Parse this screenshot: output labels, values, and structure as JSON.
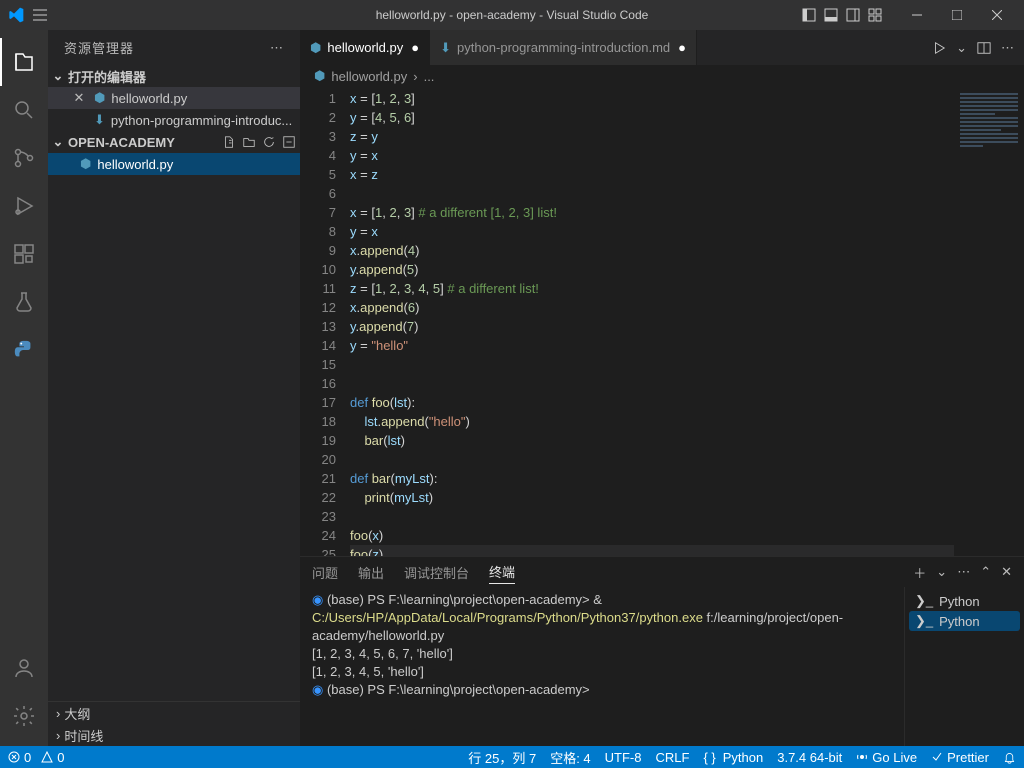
{
  "titlebar": {
    "title": "helloworld.py - open-academy - Visual Studio Code"
  },
  "sidebar": {
    "title": "资源管理器",
    "open_editors_label": "打开的编辑器",
    "open_editors": [
      {
        "name": "helloworld.py",
        "icon": "python"
      },
      {
        "name": "python-programming-introduc...",
        "icon": "markdown"
      }
    ],
    "folder": "OPEN-ACADEMY",
    "files": [
      {
        "name": "helloworld.py",
        "icon": "python"
      }
    ],
    "outline_label": "大纲",
    "timeline_label": "时间线"
  },
  "tabs": [
    {
      "name": "helloworld.py",
      "icon": "python",
      "active": true,
      "modified": true
    },
    {
      "name": "python-programming-introduction.md",
      "icon": "markdown",
      "active": false,
      "modified": true
    }
  ],
  "breadcrumb": {
    "file": "helloworld.py",
    "more": "..."
  },
  "code": {
    "lines": [
      {
        "n": 1,
        "html": "<span class='v'>x</span> <span class='p'>=</span> <span class='p'>[</span><span class='n'>1</span><span class='p'>,</span> <span class='n'>2</span><span class='p'>,</span> <span class='n'>3</span><span class='p'>]</span>"
      },
      {
        "n": 2,
        "html": "<span class='v'>y</span> <span class='p'>=</span> <span class='p'>[</span><span class='n'>4</span><span class='p'>,</span> <span class='n'>5</span><span class='p'>,</span> <span class='n'>6</span><span class='p'>]</span>"
      },
      {
        "n": 3,
        "html": "<span class='v'>z</span> <span class='p'>=</span> <span class='v'>y</span>"
      },
      {
        "n": 4,
        "html": "<span class='v'>y</span> <span class='p'>=</span> <span class='v'>x</span>"
      },
      {
        "n": 5,
        "html": "<span class='v'>x</span> <span class='p'>=</span> <span class='v'>z</span>"
      },
      {
        "n": 6,
        "html": ""
      },
      {
        "n": 7,
        "html": "<span class='v'>x</span> <span class='p'>=</span> <span class='p'>[</span><span class='n'>1</span><span class='p'>,</span> <span class='n'>2</span><span class='p'>,</span> <span class='n'>3</span><span class='p'>]</span> <span class='c'># a different [1, 2, 3] list!</span>"
      },
      {
        "n": 8,
        "html": "<span class='v'>y</span> <span class='p'>=</span> <span class='v'>x</span>"
      },
      {
        "n": 9,
        "html": "<span class='v'>x</span><span class='p'>.</span><span class='f'>append</span><span class='p'>(</span><span class='n'>4</span><span class='p'>)</span>"
      },
      {
        "n": 10,
        "html": "<span class='v'>y</span><span class='p'>.</span><span class='f'>append</span><span class='p'>(</span><span class='n'>5</span><span class='p'>)</span>"
      },
      {
        "n": 11,
        "html": "<span class='v'>z</span> <span class='p'>=</span> <span class='p'>[</span><span class='n'>1</span><span class='p'>,</span> <span class='n'>2</span><span class='p'>,</span> <span class='n'>3</span><span class='p'>,</span> <span class='n'>4</span><span class='p'>,</span> <span class='n'>5</span><span class='p'>]</span> <span class='c'># a different list!</span>"
      },
      {
        "n": 12,
        "html": "<span class='v'>x</span><span class='p'>.</span><span class='f'>append</span><span class='p'>(</span><span class='n'>6</span><span class='p'>)</span>"
      },
      {
        "n": 13,
        "html": "<span class='v'>y</span><span class='p'>.</span><span class='f'>append</span><span class='p'>(</span><span class='n'>7</span><span class='p'>)</span>"
      },
      {
        "n": 14,
        "html": "<span class='v'>y</span> <span class='p'>=</span> <span class='s'>\"hello\"</span>"
      },
      {
        "n": 15,
        "html": ""
      },
      {
        "n": 16,
        "html": ""
      },
      {
        "n": 17,
        "html": "<span class='k'>def</span> <span class='f'>foo</span><span class='p'>(</span><span class='v'>lst</span><span class='p'>):</span>"
      },
      {
        "n": 18,
        "html": "    <span class='v'>lst</span><span class='p'>.</span><span class='f'>append</span><span class='p'>(</span><span class='s'>\"hello\"</span><span class='p'>)</span>"
      },
      {
        "n": 19,
        "html": "    <span class='f'>bar</span><span class='p'>(</span><span class='v'>lst</span><span class='p'>)</span>"
      },
      {
        "n": 20,
        "html": ""
      },
      {
        "n": 21,
        "html": "<span class='k'>def</span> <span class='f'>bar</span><span class='p'>(</span><span class='v'>myLst</span><span class='p'>):</span>"
      },
      {
        "n": 22,
        "html": "    <span class='f'>print</span><span class='p'>(</span><span class='v'>myLst</span><span class='p'>)</span>"
      },
      {
        "n": 23,
        "html": ""
      },
      {
        "n": 24,
        "html": "<span class='f'>foo</span><span class='p'>(</span><span class='v'>x</span><span class='p'>)</span>"
      },
      {
        "n": 25,
        "html": "<span class='f'>foo</span><span class='p'>(</span><span class='v'>z</span><span class='p'>)</span>",
        "hl": true
      }
    ]
  },
  "panel": {
    "tabs": {
      "problems": "问题",
      "output": "输出",
      "debug_console": "调试控制台",
      "terminal": "终端"
    },
    "terminal_lines": [
      {
        "prompt": true,
        "text": "(base) PS F:\\learning\\project\\open-academy> & ",
        "cmd": "C:/Users/HP/AppData/Local/Programs/Python/Python37/python.exe",
        "arg": " f:/learning/project/open-academy/helloworld.py"
      },
      {
        "text": "[1, 2, 3, 4, 5, 6, 7, 'hello']"
      },
      {
        "text": "[1, 2, 3, 4, 5, 'hello']"
      },
      {
        "prompt": true,
        "text": "(base) PS F:\\learning\\project\\open-academy> "
      }
    ],
    "shells": [
      {
        "name": "Python"
      },
      {
        "name": "Python",
        "sel": true
      }
    ]
  },
  "statusbar": {
    "errors": "0",
    "warnings": "0",
    "ln_col": "行 25，列 7",
    "spaces": "空格: 4",
    "encoding": "UTF-8",
    "eol": "CRLF",
    "lang": "Python",
    "interp": "3.7.4 64-bit",
    "golive": "Go Live",
    "prettier": "Prettier"
  }
}
